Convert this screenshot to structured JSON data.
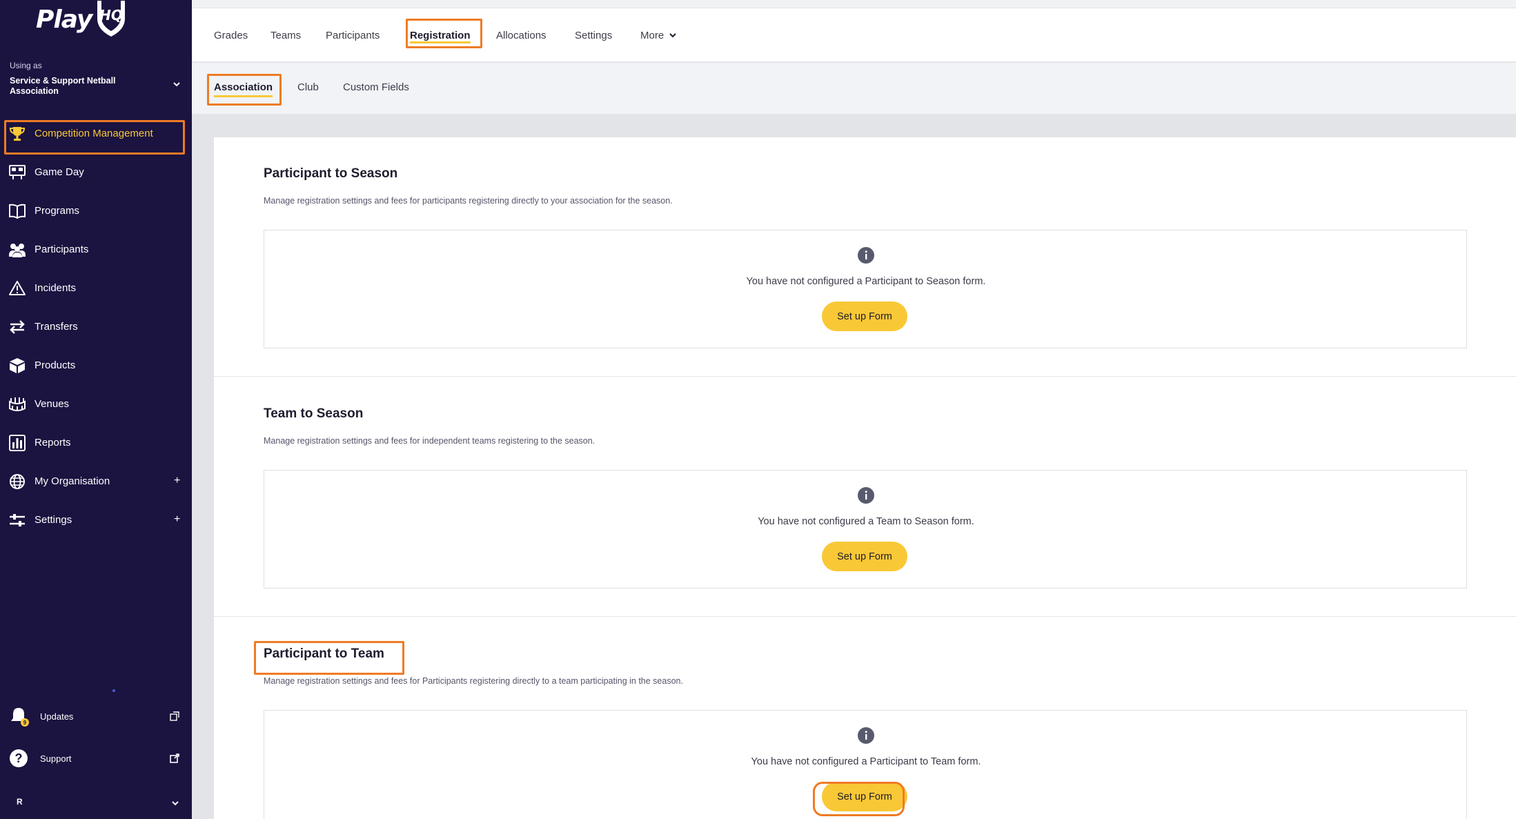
{
  "brand": {
    "logo_text": "Play",
    "logo_badge": "HQ",
    "accent": "#f9c836",
    "highlight": "#ef7b25",
    "sidebar_bg": "#1b1340"
  },
  "sidebar": {
    "using_as_label": "Using as",
    "org_name": "Service & Support Netball Association",
    "items": [
      {
        "label": "Competition Management",
        "icon": "trophy-icon",
        "active": true
      },
      {
        "label": "Game Day",
        "icon": "scoreboard-icon"
      },
      {
        "label": "Programs",
        "icon": "book-icon"
      },
      {
        "label": "Participants",
        "icon": "people-icon"
      },
      {
        "label": "Incidents",
        "icon": "warning-icon"
      },
      {
        "label": "Transfers",
        "icon": "transfer-arrows-icon"
      },
      {
        "label": "Products",
        "icon": "box-icon"
      },
      {
        "label": "Venues",
        "icon": "stadium-icon"
      },
      {
        "label": "Reports",
        "icon": "bar-chart-icon"
      },
      {
        "label": "My Organisation",
        "icon": "globe-icon",
        "expand": "+"
      },
      {
        "label": "Settings",
        "icon": "sliders-icon",
        "expand": "+"
      }
    ],
    "footer": {
      "updates_label": "Updates",
      "updates_badge": "9",
      "support_label": "Support",
      "user_initial": "R"
    }
  },
  "topnav": {
    "tabs": [
      {
        "label": "Grades"
      },
      {
        "label": "Teams"
      },
      {
        "label": "Participants"
      },
      {
        "label": "Registration",
        "active": true
      },
      {
        "label": "Allocations"
      },
      {
        "label": "Settings"
      },
      {
        "label": "More"
      }
    ]
  },
  "subnav": {
    "tabs": [
      {
        "label": "Association",
        "active": true
      },
      {
        "label": "Club"
      },
      {
        "label": "Custom Fields"
      }
    ]
  },
  "sections": [
    {
      "title": "Participant to Season",
      "description": "Manage registration settings and fees for participants registering directly to your association for the season.",
      "message": "You have not configured a Participant to Season form.",
      "button": "Set up Form"
    },
    {
      "title": "Team to Season",
      "description": "Manage registration settings and fees for independent teams registering to the season.",
      "message": "You have not configured a Team to Season form.",
      "button": "Set up Form"
    },
    {
      "title": "Participant to Team",
      "description": "Manage registration settings and fees for Participants registering directly to a team participating in the season.",
      "message": "You have not configured a Participant to Team form.",
      "button": "Set up Form"
    }
  ]
}
